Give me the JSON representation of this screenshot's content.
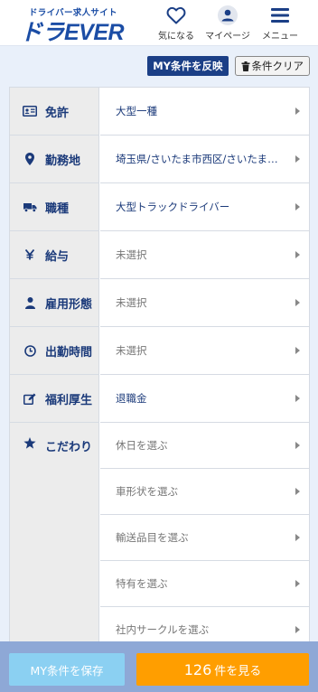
{
  "header": {
    "logo_tagline": "ドライバー求人サイト",
    "logo_text": "ドラEVER",
    "nav": [
      {
        "label": "気になる",
        "icon": "heart-icon"
      },
      {
        "label": "マイページ",
        "icon": "user-icon"
      },
      {
        "label": "メニュー",
        "icon": "hamburger-icon"
      }
    ]
  },
  "actions": {
    "reflect_label": "MY条件を反映",
    "clear_label": "条件クリア",
    "clear_icon": "trash-icon"
  },
  "criteria": [
    {
      "label": "免許",
      "icon": "id-card-icon",
      "values": [
        {
          "text": "大型一種",
          "selected": true
        }
      ]
    },
    {
      "label": "勤務地",
      "icon": "map-pin-icon",
      "values": [
        {
          "text": "埼玉県/さいたま市西区/さいたま市北区/さいたま市大宮区",
          "selected": true
        }
      ]
    },
    {
      "label": "職種",
      "icon": "truck-icon",
      "values": [
        {
          "text": "大型トラックドライバー",
          "selected": true
        }
      ]
    },
    {
      "label": "給与",
      "icon": "yen-icon",
      "values": [
        {
          "text": "未選択",
          "selected": false
        }
      ]
    },
    {
      "label": "雇用形態",
      "icon": "person-icon",
      "values": [
        {
          "text": "未選択",
          "selected": false
        }
      ]
    },
    {
      "label": "出勤時間",
      "icon": "clock-icon",
      "values": [
        {
          "text": "未選択",
          "selected": false
        }
      ]
    },
    {
      "label": "福利厚生",
      "icon": "edit-icon",
      "values": [
        {
          "text": "退職金",
          "selected": true
        }
      ]
    },
    {
      "label": "こだわり",
      "icon": "star-icon",
      "values": [
        {
          "text": "休日を選ぶ",
          "selected": false
        },
        {
          "text": "車形状を選ぶ",
          "selected": false
        },
        {
          "text": "輸送品目を選ぶ",
          "selected": false
        },
        {
          "text": "特有を選ぶ",
          "selected": false
        },
        {
          "text": "社内サークルを選ぶ",
          "selected": false
        }
      ]
    }
  ],
  "footer": {
    "save_label": "MY条件を保存",
    "count": "126",
    "count_suffix": "件を見る"
  },
  "colors": {
    "brand_navy": "#1b3f86",
    "accent_orange": "#ff9e00",
    "save_blue": "#8bd0f2"
  }
}
